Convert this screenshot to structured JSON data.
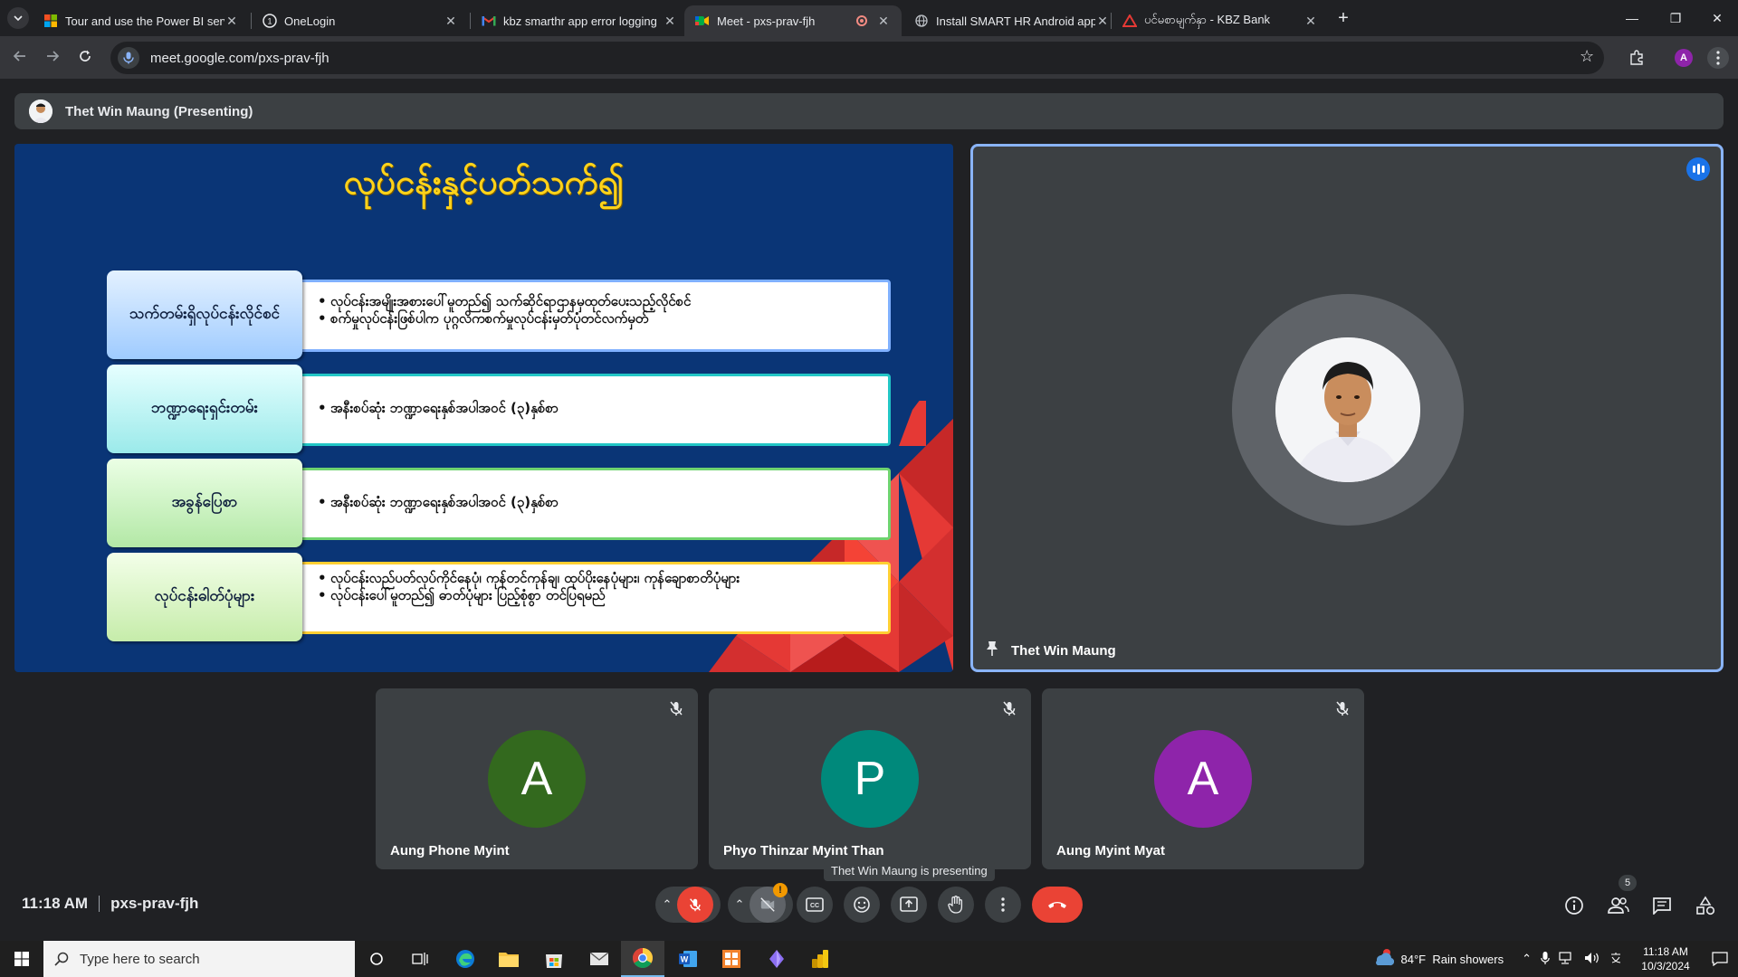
{
  "browser": {
    "tabs": [
      {
        "title": "Tour and use the Power BI servi",
        "active": false,
        "icon": "windows-logo-icon"
      },
      {
        "title": "OneLogin",
        "active": false,
        "icon": "onelogin-icon"
      },
      {
        "title": "kbz smarthr app error logging",
        "active": false,
        "icon": "gmail-icon"
      },
      {
        "title": "Meet - pxs-prav-fjh",
        "active": true,
        "icon": "google-meet-icon"
      },
      {
        "title": "Install SMART HR Android app",
        "active": false,
        "icon": "globe-icon"
      },
      {
        "title": "ပင်မစာမျက်နှာ - KBZ Bank",
        "active": false,
        "icon": "kbz-icon"
      }
    ],
    "url": "meet.google.com/pxs-prav-fjh",
    "profile_initial": "A"
  },
  "meet": {
    "presenting_bar": "Thet Win Maung (Presenting)",
    "presenting_tooltip": "Thet Win Maung is presenting",
    "time": "11:18 AM",
    "meeting_code": "pxs-prav-fjh",
    "people_count": "5",
    "main_tile_name": "Thet Win Maung",
    "participants": [
      {
        "name": "Aung Phone Myint",
        "initial": "A",
        "color": "#33691e"
      },
      {
        "name": "Phyo Thinzar Myint Than",
        "initial": "P",
        "color": "#00897b"
      },
      {
        "name": "Aung Myint Myat",
        "initial": "A",
        "color": "#8e24aa"
      }
    ],
    "camera_badge": "!"
  },
  "slide": {
    "title": "လုပ်ငန်းနှင့်ပတ်သက်၍",
    "rows": [
      {
        "label": "သက်တမ်းရှိလုပ်ငန်းလိုင်စင်",
        "label_color": "#b9dcff",
        "border_color": "#7fb0ff",
        "bullets": [
          "လုပ်ငန်းအမျိုးအစားပေါ်မူတည်၍ သက်ဆိုင်ရာဌာနမှထုတ်ပေးသည့်လိုင်စင်",
          "စက်မှုလုပ်ငန်းဖြစ်ပါက ပုဂ္ဂလိကစက်မှုလုပ်ငန်းမှတ်ပုံတင်လက်မှတ်"
        ]
      },
      {
        "label": "ဘဏ္ဍာရေးရှင်းတမ်း",
        "label_color": "#b8f4f4",
        "border_color": "#22c6c6",
        "bullets": [
          "အနီးစပ်ဆုံး ဘဏ္ဍာရေးနှစ်အပါအဝင် (၃)နှစ်စာ"
        ]
      },
      {
        "label": "အခွန်ပြေစာ",
        "label_color": "#cdf2c4",
        "border_color": "#6fd36f",
        "bullets": [
          "အနီးစပ်ဆုံး ဘဏ္ဍာရေးနှစ်အပါအဝင် (၃)နှစ်စာ"
        ]
      },
      {
        "label": "လုပ်ငန်းဓါတ်ပုံများ",
        "label_color": "#dcf6c8",
        "border_color": "#ffcf33",
        "bullets": [
          "လုပ်ငန်းလည်ပတ်လုပ်ကိုင်နေပုံ၊ ကုန်တင်ကုန်ချ၊ ထုပ်ပိုးနေပုံများ၊ ကုန်ချောစာတိပုံများ",
          "လုပ်ငန်းပေါ်မူတည်၍ ဓာတ်ပုံများ ပြည့်စုံစွာ တင်ပြရမည်"
        ]
      }
    ]
  },
  "taskbar": {
    "search_placeholder": "Type here to search",
    "weather": "84°F  Rain showers",
    "clock_time": "11:18 AM",
    "clock_date": "10/3/2024"
  }
}
